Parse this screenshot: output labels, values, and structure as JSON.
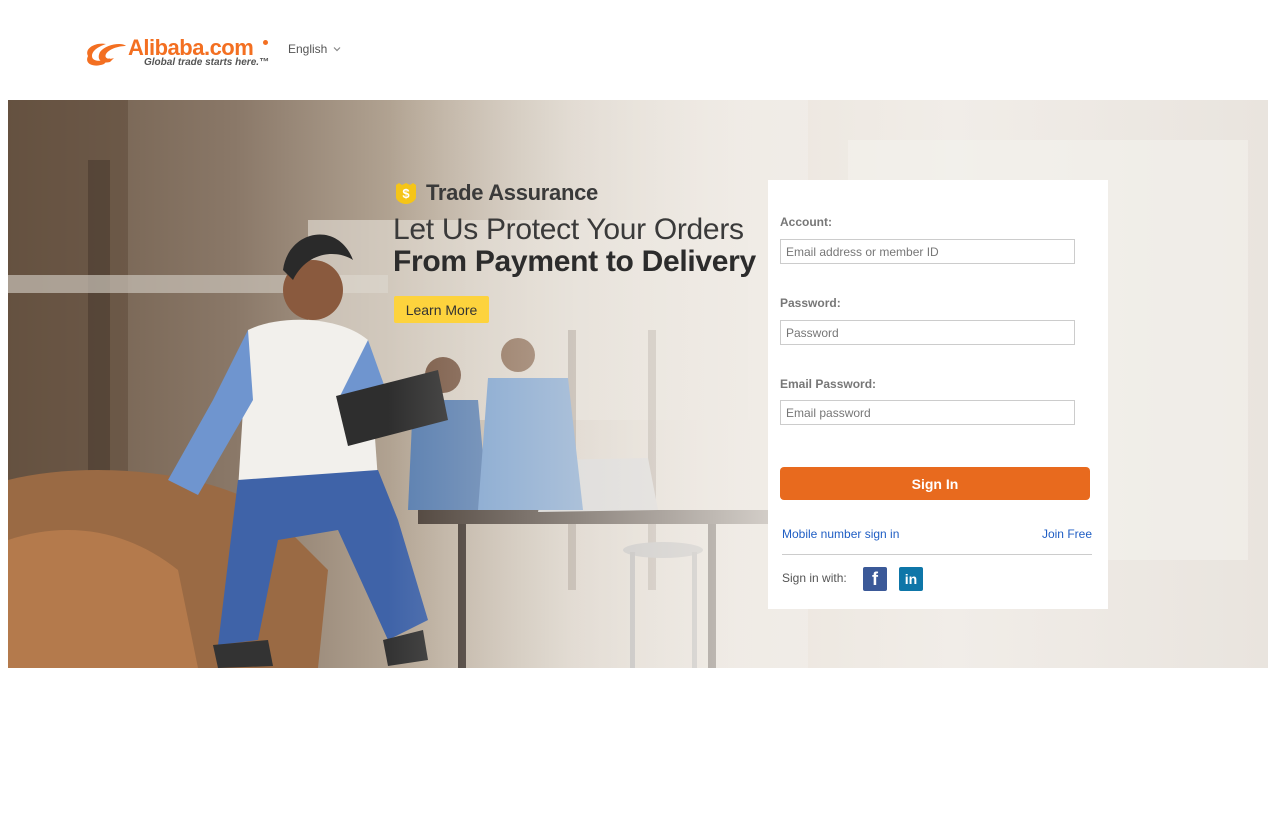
{
  "header": {
    "logo_text": "Alibaba.com",
    "logo_tagline": "Global trade starts here.™",
    "language": "English"
  },
  "hero": {
    "badge": "Trade Assurance",
    "headline_line1": "Let Us Protect Your Orders",
    "headline_line2": "From Payment to Delivery",
    "cta_label": "Learn More"
  },
  "login": {
    "account_label": "Account:",
    "account_placeholder": "Email address or member ID",
    "password_label": "Password:",
    "password_placeholder": "Password",
    "email_password_label": "Email Password:",
    "email_password_placeholder": "Email password",
    "signin_label": "Sign In",
    "mobile_link": "Mobile number sign in",
    "join_link": "Join Free",
    "signin_with": "Sign in with:",
    "social": [
      {
        "name": "facebook-icon",
        "glyph": "f"
      },
      {
        "name": "linkedin-icon",
        "glyph": "in"
      }
    ]
  },
  "colors": {
    "brand_orange": "#f36f21",
    "signin_button": "#e86a1e",
    "cta_yellow": "#fdd33d",
    "link_blue": "#1f5ec4"
  }
}
